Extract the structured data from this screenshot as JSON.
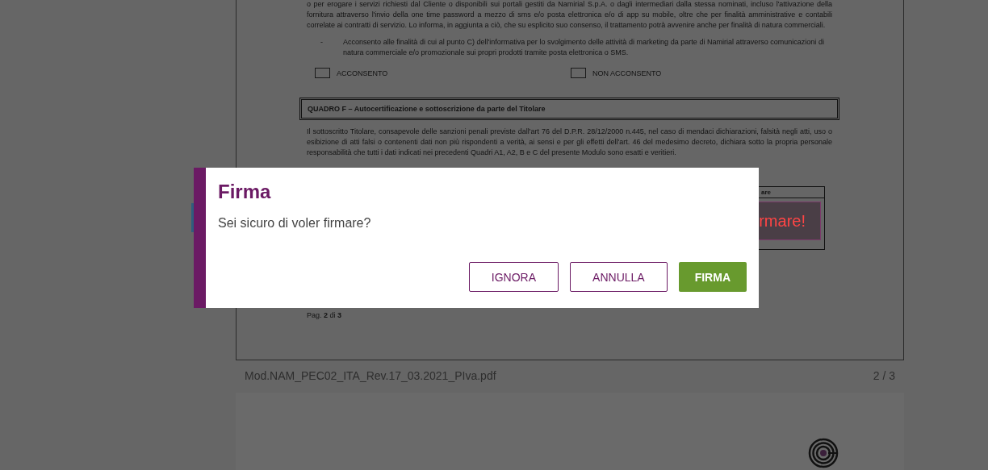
{
  "document": {
    "paragraphs": [
      {
        "kind": "text",
        "text": "o per erogare i servizi richiesti dal Cliente o disponibili sui portali gestiti da Namirial S.p.A. o dagli intermediari dalla stessa nominati, incluso l'attivazione della fornitura attraverso l'invio della one time password a mezzo di sms e/o posta elettronica e/o di app su mobile, oltre che per finalità amministrative e contabili correlate ai contratti di servizio. Lo informa, in aggiunta a ciò, che su esplicito suo consenso, il trattamento potrà avvenire anche per finalità di natura commerciali."
      },
      {
        "kind": "bullet",
        "bullet": "-",
        "text": "Acconsento alle finalità di cui al punto C) dell'informativa per lo svolgimento delle attività di marketing da parte di Namirial attraverso comunicazioni di natura commerciale e/o promozionale sui propri prodotti tramite posta elettronica o SMS."
      }
    ],
    "consent_options": [
      {
        "label": "ACCONSENTO",
        "checked": false
      },
      {
        "label": "NON ACCONSENTO",
        "checked": false
      }
    ],
    "section_title": "QUADRO F – Autocertificazione e sottoscrizione da parte del Titolare",
    "section_text": "Il sottoscritto Titolare, consapevole delle sanzioni penali previste dall'art 76 del D.P.R. 28/12/2000 n.445, nel caso di mendaci dichiarazioni, falsità negli atti, uso o esibizione di atti falsi o contenenti dati non più rispondenti a verità, ai sensi e per gli effetti dell'art. 46 del medesimo decreto, dichiara sotto la propria personale responsabilità che tutti i dati indicati nei precedenti Quadri A1, A2, B e C del presente Modulo sono esatti e veritieri.",
    "signature_box": {
      "header": "are",
      "prompt": "rmare!"
    },
    "page_label": "Pag. **2** di **3**"
  },
  "file_bar": {
    "filename": "Mod.NAM_PEC02_ITA_Rev.17_03.2021_PIva.pdf",
    "page_count": "2 / 3"
  },
  "dialog": {
    "title": "Firma",
    "message": "Sei sicuro di voler firmare?",
    "buttons": [
      {
        "label": "IGNORA",
        "kind": "outline"
      },
      {
        "label": "ANNULLA",
        "kind": "outline"
      },
      {
        "label": "FIRMA",
        "kind": "primary"
      }
    ]
  }
}
